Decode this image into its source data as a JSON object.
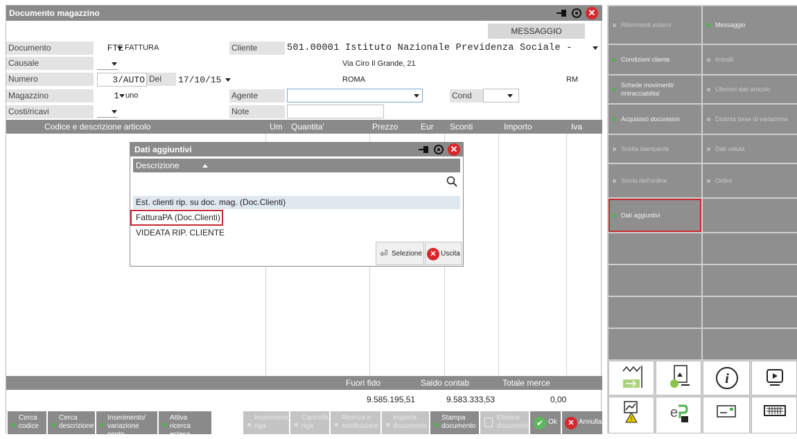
{
  "window": {
    "title": "Documento magazzino",
    "message_button": "MESSAGGIO"
  },
  "header": {
    "documento": {
      "label": "Documento",
      "code": "FTE",
      "value": "FATTURA"
    },
    "causale": {
      "label": "Causale"
    },
    "numero": {
      "label": "Numero",
      "value": "3/AUTO",
      "del_label": "Del",
      "date": "17/10/15"
    },
    "magazzino": {
      "label": "Magazzino",
      "code": "1",
      "value": "uno"
    },
    "costi_ricavi": {
      "label": "Costi/ricavi"
    },
    "cliente": {
      "label": "Cliente",
      "value": "501.00001 Istituto Nazionale Previdenza Sociale -",
      "address": "Via Ciro Il Grande, 21",
      "city": "ROMA",
      "province": "RM"
    },
    "agente": {
      "label": "Agente"
    },
    "cond": {
      "label": "Cond"
    },
    "note": {
      "label": "Note"
    }
  },
  "grid": {
    "columns": [
      "Codice e descrizione articolo",
      "Um",
      "Quantita'",
      "Prezzo",
      "Eur",
      "Sconti",
      "Importo",
      "Iva"
    ]
  },
  "totals": {
    "fuori_fido": {
      "label": "Fuori fido",
      "value": "9.585.195,51"
    },
    "saldo_contab": {
      "label": "Saldo contab",
      "value": "9.583.333,53"
    },
    "totale_merce": {
      "label": "Totale merce",
      "value": "0,00"
    }
  },
  "toolbar": [
    {
      "line1": "Cerca",
      "line2": "codice",
      "enabled": true
    },
    {
      "line1": "Cerca",
      "line2": "descrizione",
      "enabled": true
    },
    {
      "line1": "Inserimento/",
      "line2": "variazione conto",
      "enabled": true
    },
    {
      "line1": "Attiva ricerca",
      "line2": "estesa",
      "enabled": true
    },
    {
      "line1": "Inserimento",
      "line2": "riga",
      "enabled": false
    },
    {
      "line1": "Cancella",
      "line2": "riga",
      "enabled": false
    },
    {
      "line1": "Ricerca e",
      "line2": "sostituzione",
      "enabled": false
    },
    {
      "line1": "Importa",
      "line2": "documento",
      "enabled": false
    },
    {
      "line1": "Stampa",
      "line2": "documento",
      "enabled": true
    },
    {
      "line1": "Elimina",
      "line2": "documento",
      "enabled": false
    },
    {
      "line1": "Ok",
      "line2": "",
      "enabled": true
    },
    {
      "line1": "Annulla",
      "line2": "",
      "enabled": true
    }
  ],
  "dialog": {
    "title": "Dati aggiuntivi",
    "column": "Descrizione",
    "rows": [
      "Est. clienti rip. su doc. mag. (Doc.Clienti)",
      "FatturaPA (Doc.Clienti)",
      "VIDEATA RIP. CLIENTE"
    ],
    "selezione_label": "Selezione",
    "uscita_label": "Uscita"
  },
  "right_panel": {
    "buttons": [
      {
        "label": "Riferimenti esterni",
        "enabled": false
      },
      {
        "label": "Messaggio",
        "enabled": true
      },
      {
        "label": "Condizioni cliente",
        "enabled": true
      },
      {
        "label": "Imballi",
        "enabled": false
      },
      {
        "label": "Schede movimenti/ rintracciabilita'",
        "enabled": true
      },
      {
        "label": "Ulteriori dati articolo",
        "enabled": false
      },
      {
        "label": "Acquisisci docuvision",
        "enabled": true
      },
      {
        "label": "Distinta base di variazione",
        "enabled": false
      },
      {
        "label": "Scelta stampante",
        "enabled": false
      },
      {
        "label": "Dati valuta",
        "enabled": false
      },
      {
        "label": "Storia dell'ordine",
        "enabled": false
      },
      {
        "label": "Ordini",
        "enabled": false
      },
      {
        "label": "Dati aggiuntivi",
        "enabled": true
      }
    ],
    "icons": [
      "barcode-transfer-icon",
      "document-image-icon",
      "info-icon",
      "screen-play-icon",
      "chart-warning-icon",
      "epa-lock-icon",
      "card-icon",
      "keyboard-icon"
    ]
  },
  "colors": {
    "bar_gray": "#8a8a8a",
    "accent_green": "#4db34d",
    "highlight_red": "#c8282f",
    "close_red": "#d8272d"
  }
}
